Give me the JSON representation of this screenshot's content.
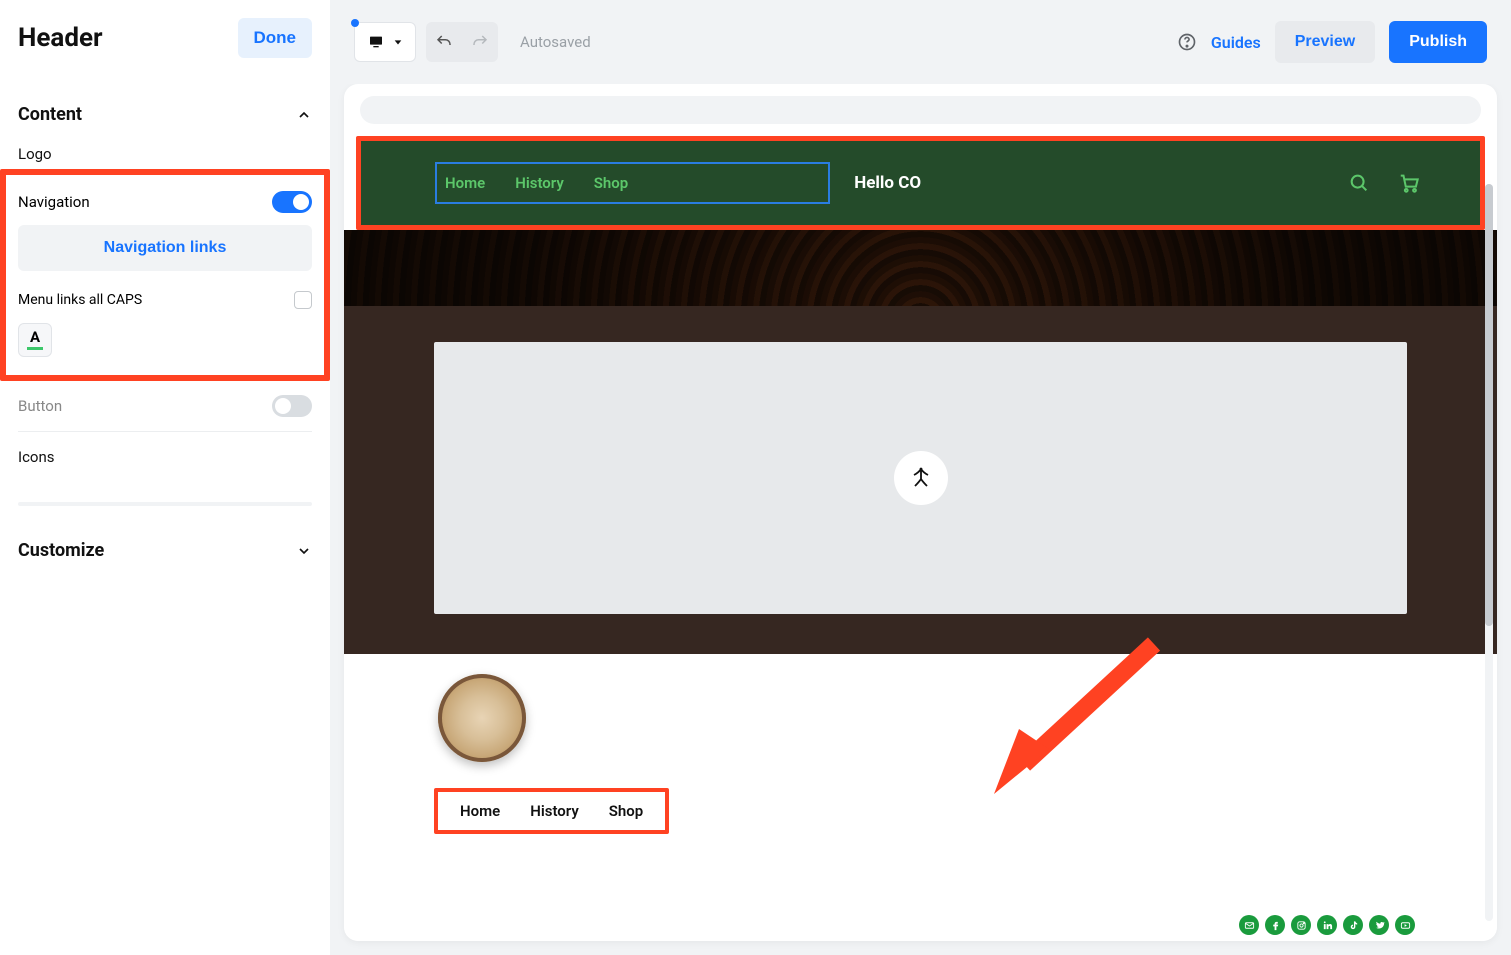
{
  "sidebar": {
    "title": "Header",
    "done_label": "Done",
    "sections": {
      "content": {
        "label": "Content",
        "expanded": true
      },
      "customize": {
        "label": "Customize",
        "expanded": false
      }
    },
    "logo_label": "Logo",
    "navigation_label": "Navigation",
    "navigation_on": true,
    "navlinks_button": "Navigation links",
    "caps_label": "Menu links all CAPS",
    "caps_checked": false,
    "text_color_glyph": "A",
    "button_label": "Button",
    "button_on": false,
    "icons_label": "Icons"
  },
  "topbar": {
    "autosaved": "Autosaved",
    "guides": "Guides",
    "preview": "Preview",
    "publish": "Publish"
  },
  "site": {
    "nav_items": [
      "Home",
      "History",
      "Shop"
    ],
    "title": "Hello CO"
  },
  "footer": {
    "nav_items": [
      "Home",
      "History",
      "Shop"
    ],
    "social": [
      "email",
      "facebook",
      "instagram",
      "linkedin",
      "tiktok",
      "twitter",
      "youtube"
    ]
  }
}
